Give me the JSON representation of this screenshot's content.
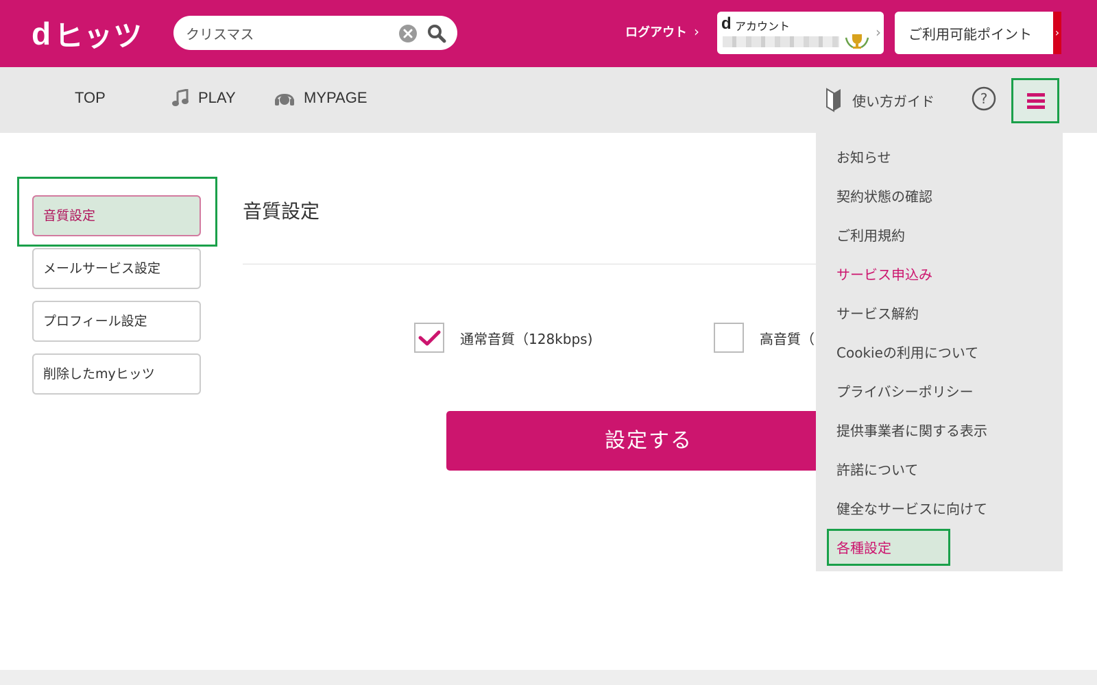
{
  "header": {
    "logo_d": "d",
    "logo_text": "ヒッツ",
    "search_value": "クリスマス",
    "logout_label": "ログアウト",
    "account_label": "アカウント",
    "account_d": "d",
    "points_label": "ご利用可能ポイント",
    "brand_color": "#cc156e"
  },
  "nav": {
    "top": "TOP",
    "play": "PLAY",
    "mypage": "MYPAGE",
    "guide": "使い方ガイド"
  },
  "sidebar": {
    "items": [
      {
        "label": "音質設定"
      },
      {
        "label": "メールサービス設定"
      },
      {
        "label": "プロフィール設定"
      },
      {
        "label": "削除したmyヒッツ"
      }
    ]
  },
  "main": {
    "title": "音質設定",
    "options": [
      {
        "label": "通常音質（128kbps)",
        "checked": true
      },
      {
        "label": "高音質（",
        "checked": false
      }
    ],
    "submit_label": "設定する"
  },
  "dropdown": {
    "items": [
      {
        "label": "お知らせ"
      },
      {
        "label": "契約状態の確認"
      },
      {
        "label": "ご利用規約"
      },
      {
        "label": "サービス申込み"
      },
      {
        "label": "サービス解約"
      },
      {
        "label": "Cookieの利用について"
      },
      {
        "label": "プライバシーポリシー"
      },
      {
        "label": "提供事業者に関する表示"
      },
      {
        "label": "許諾について"
      },
      {
        "label": "健全なサービスに向けて"
      },
      {
        "label": "各種設定"
      }
    ]
  }
}
